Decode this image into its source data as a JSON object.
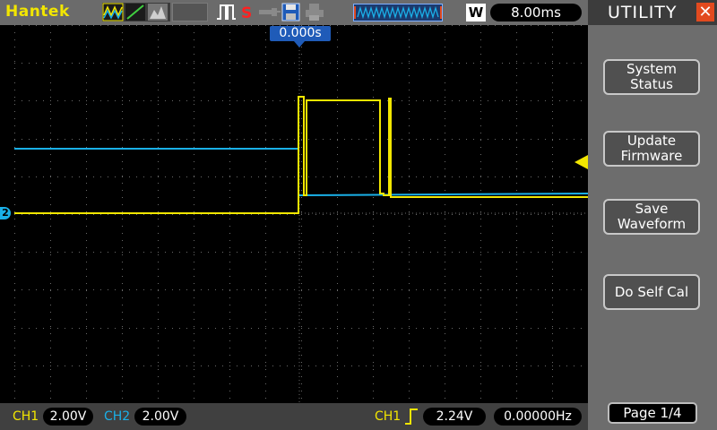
{
  "brand": "Hantek",
  "timebase": {
    "label": "W",
    "value": "8.00ms"
  },
  "trigger_position": "0.000s",
  "side_panel": {
    "title": "UTILITY",
    "close_icon": "close-icon",
    "buttons": [
      {
        "label": "System\nStatus"
      },
      {
        "label": "Update\nFirmware"
      },
      {
        "label": "Save\nWaveform"
      },
      {
        "label": "Do Self Cal"
      }
    ],
    "page": "Page 1/4"
  },
  "channels": {
    "ch1": {
      "label": "CH1",
      "volts_div": "2.00V",
      "color": "#f2e600"
    },
    "ch2": {
      "label": "CH2",
      "volts_div": "2.00V",
      "color": "#1ab0e8"
    },
    "ch2_marker": "2"
  },
  "trigger": {
    "source": "CH1",
    "edge_icon": "rising-edge-icon",
    "level": "2.24V",
    "frequency": "0.00000Hz"
  },
  "toolbar_icons": [
    "triangle-wave-icon",
    "ramp-icon",
    "envelope-icon",
    "pulse-icon",
    "stop-icon",
    "probe-icon",
    "floppy-save-icon",
    "printer-icon",
    "memory-waveform-icon"
  ],
  "colors": {
    "ch1": "#f2e600",
    "ch2": "#1ab0e8",
    "accent": "#1f5bb8",
    "close": "#e24a1f"
  }
}
